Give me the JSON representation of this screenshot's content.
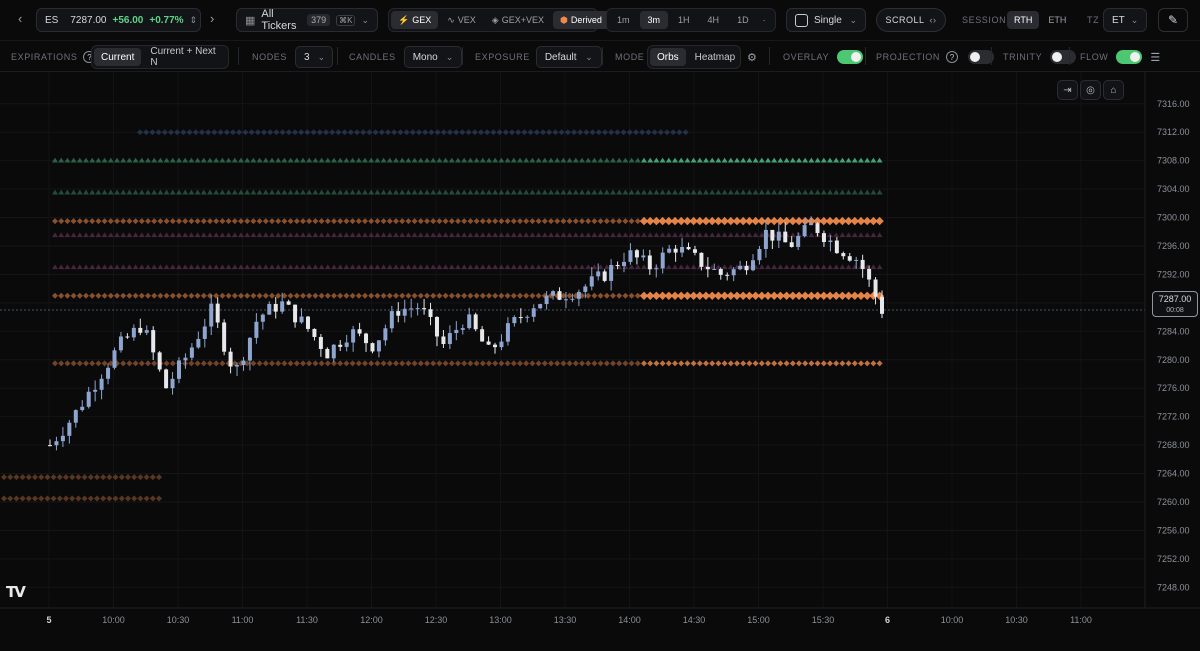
{
  "header": {
    "symbol": "ES",
    "price": "7287.00",
    "change": "+56.00",
    "change_pct": "+0.77%",
    "tickers_label": "All Tickers",
    "tickers_count": "379",
    "tickers_kbd": "⌘K",
    "metrics": [
      "GEX",
      "VEX",
      "GEX+VEX",
      "Derived"
    ],
    "metric_active": "GEX",
    "timeframes": [
      "1m",
      "3m",
      "1H",
      "4H",
      "1D"
    ],
    "timeframe_active": "3m",
    "layout": "Single",
    "scroll_label": "SCROLL",
    "session_label": "SESSION",
    "sessions": [
      "RTH",
      "ETH"
    ],
    "session_active": "RTH",
    "tz_label": "TZ",
    "tz_value": "ET"
  },
  "toolbar": {
    "expirations_label": "EXPIRATIONS",
    "expirations": [
      "Current",
      "Current + Next N"
    ],
    "nodes_label": "NODES",
    "nodes_value": "3",
    "candles_label": "CANDLES",
    "candles_value": "Mono",
    "exposure_label": "EXPOSURE",
    "exposure_value": "Default",
    "mode_label": "MODE",
    "modes": [
      "Orbs",
      "Heatmap"
    ],
    "overlay_label": "OVERLAY",
    "overlay_on": true,
    "projection_label": "PROJECTION",
    "projection_on": false,
    "trinity_label": "TRINITY",
    "trinity_on": false,
    "flow_label": "FLOW",
    "flow_on": true
  },
  "colors": {
    "bg": "#0a0a0b",
    "candle": "#8fa6d0",
    "orange": "#f08a4b",
    "green": "#4ec98b",
    "purple": "#b05a98",
    "blue": "#4f6fb8",
    "accent_toggle": "#4cc872"
  },
  "current_price": {
    "value": "7287.00",
    "timer": "00:08"
  },
  "chart_data": {
    "type": "candlestick",
    "title": "",
    "x_ticks": [
      "5",
      "10:00",
      "10:30",
      "11:00",
      "11:30",
      "12:00",
      "12:30",
      "13:00",
      "13:30",
      "14:00",
      "14:30",
      "15:00",
      "15:30",
      "6",
      "10:00",
      "10:30",
      "11:00"
    ],
    "y_ticks": [
      "7316.00",
      "7312.00",
      "7308.00",
      "7304.00",
      "7300.00",
      "7296.00",
      "7292.00",
      "7288.00",
      "7284.00",
      "7280.00",
      "7276.00",
      "7272.00",
      "7268.00",
      "7264.00",
      "7260.00",
      "7256.00",
      "7252.00",
      "7248.00"
    ],
    "ylim": [
      7246.5,
      7318.5
    ],
    "close_path": [
      7268,
      7272,
      7277,
      7282,
      7285,
      7276,
      7281,
      7287,
      7278,
      7286,
      7288,
      7285,
      7281,
      7284,
      7282,
      7287,
      7287.5,
      7282,
      7286,
      7281,
      7285,
      7288,
      7289,
      7290,
      7292,
      7295,
      7293,
      7296,
      7294,
      7292,
      7293,
      7298,
      7296,
      7299,
      7296,
      7294,
      7287
    ],
    "gex_levels": [
      {
        "price": 7299.5,
        "color": "orange",
        "weight": "strong"
      },
      {
        "price": 7289.0,
        "color": "orange",
        "weight": "strong"
      },
      {
        "price": 7279.5,
        "color": "orange",
        "weight": "medium"
      },
      {
        "price": 7308.0,
        "color": "green",
        "weight": "medium"
      },
      {
        "price": 7303.5,
        "color": "green",
        "weight": "weak"
      },
      {
        "price": 7312.0,
        "color": "blue",
        "weight": "weak"
      },
      {
        "price": 7297.5,
        "color": "purple",
        "weight": "weak"
      },
      {
        "price": 7293.0,
        "color": "purple",
        "weight": "weak"
      },
      {
        "price": 7263.5,
        "color": "orange",
        "weight": "weak"
      },
      {
        "price": 7260.5,
        "color": "orange",
        "weight": "weak"
      }
    ]
  }
}
